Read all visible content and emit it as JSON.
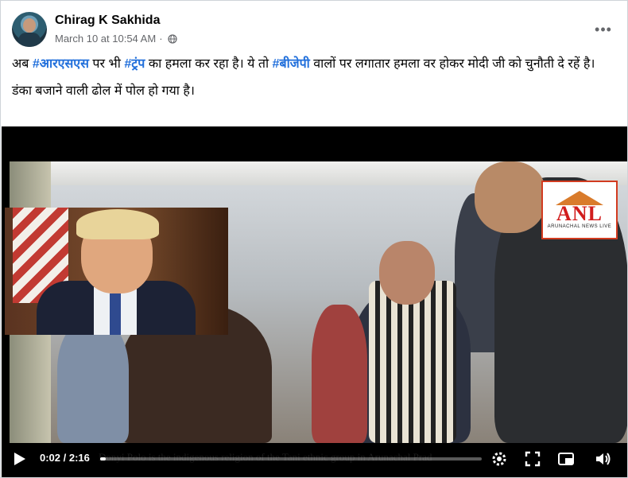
{
  "post": {
    "author": "Chirag K Sakhida",
    "timestamp": "March 10 at 10:54 AM",
    "separator": "·",
    "privacy_icon": "globe-icon",
    "more_label": "•••",
    "line1": {
      "t1": "अब ",
      "tag1": "#आरएसएस",
      "t2": " पर भी ",
      "tag2": "#ट्रंप",
      "t3": " का हमला कर रहा है। ये तो ",
      "tag3": "#बीजेपी",
      "t4": " वालों पर लगातार हमला वर होकर मोदी जी को चुनौती दे रहें है।"
    },
    "line2": "डंका बजाने वाली ढोल में पोल हो गया है।"
  },
  "video": {
    "logo_text": "ANL",
    "logo_tagline": "ARUNACHAL NEWS LIVE",
    "subtitle": "Donyi Polo is the indigenous religion of the Tani ethnic group in Arunachal Prad",
    "time_display": "0:02 / 2:16",
    "progress_fraction": 0.015,
    "colors": {
      "hashtag": "#216fdb",
      "logo_red": "#d11d1d"
    },
    "icons": [
      "play-icon",
      "settings-gear-icon",
      "fullscreen-icon",
      "picture-in-picture-icon",
      "volume-icon"
    ]
  }
}
